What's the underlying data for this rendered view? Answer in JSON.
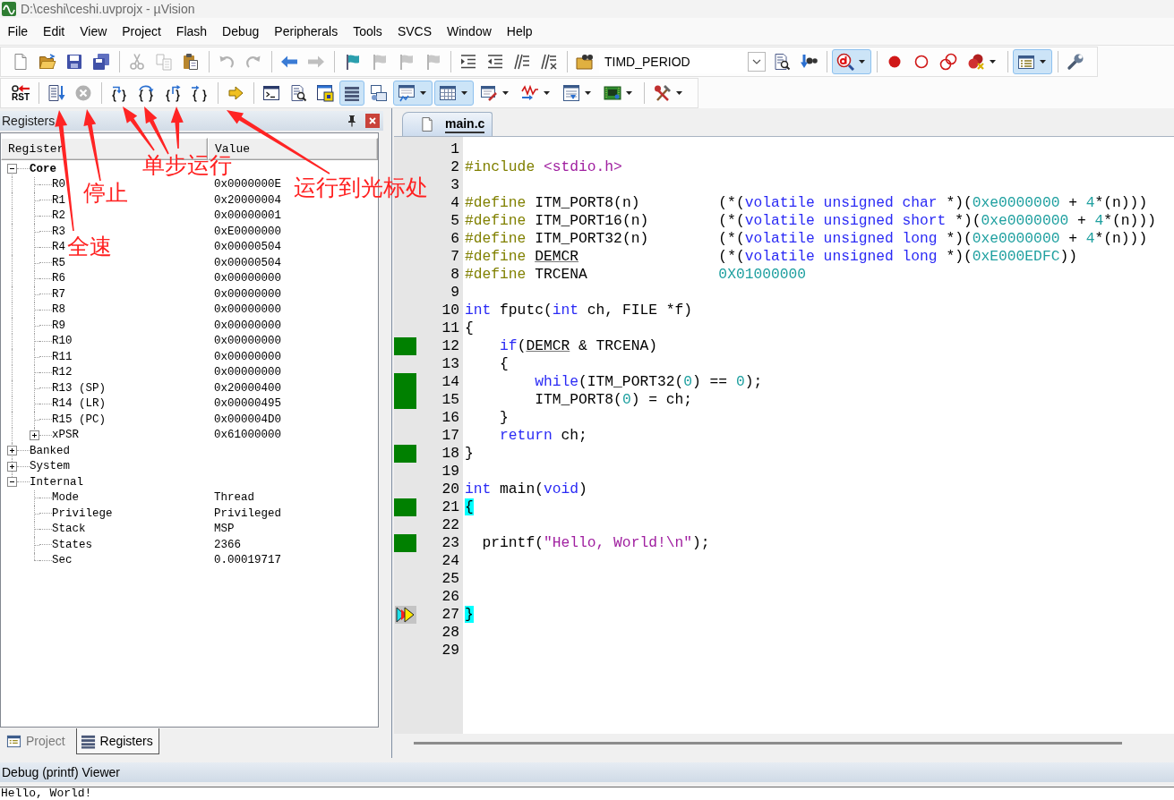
{
  "window": {
    "title": "D:\\ceshi\\ceshi.uvprojx - µVision"
  },
  "menu": [
    "File",
    "Edit",
    "View",
    "Project",
    "Flash",
    "Debug",
    "Peripherals",
    "Tools",
    "SVCS",
    "Window",
    "Help"
  ],
  "toolbar_1": {
    "items": [
      {
        "kind": "button",
        "disabled": false,
        "pressed": false,
        "dropdown": false
      },
      {
        "kind": "button",
        "disabled": false,
        "pressed": false,
        "dropdown": false
      },
      {
        "kind": "button",
        "disabled": false,
        "pressed": false,
        "dropdown": false
      },
      {
        "kind": "button",
        "disabled": false,
        "pressed": false,
        "dropdown": false
      },
      {
        "kind": "separator"
      },
      {
        "kind": "button",
        "disabled": true,
        "pressed": false,
        "dropdown": false
      },
      {
        "kind": "button",
        "disabled": true,
        "pressed": false,
        "dropdown": false
      },
      {
        "kind": "button",
        "disabled": false,
        "pressed": false,
        "dropdown": false
      },
      {
        "kind": "separator"
      },
      {
        "kind": "button",
        "disabled": true,
        "pressed": false,
        "dropdown": false
      },
      {
        "kind": "button",
        "disabled": true,
        "pressed": false,
        "dropdown": false
      },
      {
        "kind": "separator"
      },
      {
        "kind": "button",
        "disabled": false,
        "pressed": false,
        "dropdown": false
      },
      {
        "kind": "button",
        "disabled": true,
        "pressed": false,
        "dropdown": false
      },
      {
        "kind": "separator"
      },
      {
        "kind": "button",
        "disabled": false,
        "pressed": false,
        "dropdown": false
      },
      {
        "kind": "button",
        "disabled": true,
        "pressed": false,
        "dropdown": false
      },
      {
        "kind": "button",
        "disabled": true,
        "pressed": false,
        "dropdown": false
      },
      {
        "kind": "button",
        "disabled": true,
        "pressed": false,
        "dropdown": false
      },
      {
        "kind": "separator"
      },
      {
        "kind": "button",
        "disabled": false,
        "pressed": false,
        "dropdown": false
      },
      {
        "kind": "button",
        "disabled": false,
        "pressed": false,
        "dropdown": false
      },
      {
        "kind": "button",
        "disabled": false,
        "pressed": false,
        "dropdown": false
      },
      {
        "kind": "button",
        "disabled": false,
        "pressed": false,
        "dropdown": false
      },
      {
        "kind": "separator"
      },
      {
        "kind": "button",
        "disabled": false,
        "pressed": false,
        "dropdown": false
      },
      {
        "kind": "combo",
        "value": "TIMD_PERIOD"
      },
      {
        "kind": "button",
        "disabled": false,
        "pressed": false,
        "dropdown": false
      },
      {
        "kind": "button",
        "disabled": false,
        "pressed": false,
        "dropdown": false
      },
      {
        "kind": "separator"
      },
      {
        "kind": "button",
        "disabled": false,
        "pressed": true,
        "dropdown": true
      },
      {
        "kind": "separator"
      },
      {
        "kind": "button",
        "disabled": false,
        "pressed": false,
        "dropdown": false
      },
      {
        "kind": "button",
        "disabled": false,
        "pressed": false,
        "dropdown": false
      },
      {
        "kind": "button",
        "disabled": false,
        "pressed": false,
        "dropdown": false
      },
      {
        "kind": "button",
        "disabled": false,
        "pressed": false,
        "dropdown": true
      },
      {
        "kind": "separator"
      },
      {
        "kind": "button",
        "disabled": false,
        "pressed": true,
        "dropdown": true
      },
      {
        "kind": "separator"
      },
      {
        "kind": "button",
        "disabled": false,
        "pressed": false,
        "dropdown": false
      }
    ]
  },
  "toolbar_2": {
    "items": [
      {
        "kind": "button",
        "label": "RST",
        "disabled": false,
        "pressed": false,
        "dropdown": false
      },
      {
        "kind": "separator"
      },
      {
        "kind": "button",
        "disabled": false,
        "pressed": false,
        "dropdown": false
      },
      {
        "kind": "button",
        "disabled": true,
        "pressed": false,
        "dropdown": false
      },
      {
        "kind": "separator"
      },
      {
        "kind": "button",
        "disabled": false,
        "pressed": false,
        "dropdown": false
      },
      {
        "kind": "button",
        "disabled": false,
        "pressed": false,
        "dropdown": false
      },
      {
        "kind": "button",
        "disabled": false,
        "pressed": false,
        "dropdown": false
      },
      {
        "kind": "button",
        "disabled": false,
        "pressed": false,
        "dropdown": false
      },
      {
        "kind": "separator"
      },
      {
        "kind": "button",
        "disabled": false,
        "pressed": false,
        "dropdown": false
      },
      {
        "kind": "separator"
      },
      {
        "kind": "button",
        "disabled": false,
        "pressed": false,
        "dropdown": false
      },
      {
        "kind": "button",
        "disabled": false,
        "pressed": false,
        "dropdown": false
      },
      {
        "kind": "button",
        "disabled": false,
        "pressed": false,
        "dropdown": false
      },
      {
        "kind": "button",
        "disabled": false,
        "pressed": true,
        "dropdown": false
      },
      {
        "kind": "button",
        "disabled": false,
        "pressed": false,
        "dropdown": false
      },
      {
        "kind": "button",
        "disabled": false,
        "pressed": true,
        "dropdown": true
      },
      {
        "kind": "button",
        "disabled": false,
        "pressed": true,
        "dropdown": true
      },
      {
        "kind": "button",
        "disabled": false,
        "pressed": false,
        "dropdown": true
      },
      {
        "kind": "button",
        "disabled": false,
        "pressed": false,
        "dropdown": true
      },
      {
        "kind": "button",
        "disabled": false,
        "pressed": false,
        "dropdown": true
      },
      {
        "kind": "button",
        "disabled": false,
        "pressed": false,
        "dropdown": true
      },
      {
        "kind": "separator"
      },
      {
        "kind": "button",
        "disabled": false,
        "pressed": false,
        "dropdown": true
      }
    ]
  },
  "registers": {
    "title": "Registers",
    "columns": [
      "Register",
      "Value"
    ],
    "tree": [
      {
        "name": "Core",
        "bold": true,
        "expanded": true,
        "children": [
          {
            "name": "R0",
            "value": "0x0000000E"
          },
          {
            "name": "R1",
            "value": "0x20000004"
          },
          {
            "name": "R2",
            "value": "0x00000001"
          },
          {
            "name": "R3",
            "value": "0xE0000000"
          },
          {
            "name": "R4",
            "value": "0x00000504"
          },
          {
            "name": "R5",
            "value": "0x00000504"
          },
          {
            "name": "R6",
            "value": "0x00000000"
          },
          {
            "name": "R7",
            "value": "0x00000000"
          },
          {
            "name": "R8",
            "value": "0x00000000"
          },
          {
            "name": "R9",
            "value": "0x00000000"
          },
          {
            "name": "R10",
            "value": "0x00000000"
          },
          {
            "name": "R11",
            "value": "0x00000000"
          },
          {
            "name": "R12",
            "value": "0x00000000"
          },
          {
            "name": "R13 (SP)",
            "value": "0x20000400"
          },
          {
            "name": "R14 (LR)",
            "value": "0x00000495"
          },
          {
            "name": "R15 (PC)",
            "value": "0x000004D0"
          },
          {
            "name": "xPSR",
            "value": "0x61000000",
            "expanded": false
          }
        ]
      },
      {
        "name": "Banked",
        "bold": false,
        "expanded": false
      },
      {
        "name": "System",
        "bold": false,
        "expanded": false
      },
      {
        "name": "Internal",
        "bold": false,
        "expanded": true,
        "children": [
          {
            "name": "Mode",
            "value": "Thread"
          },
          {
            "name": "Privilege",
            "value": "Privileged"
          },
          {
            "name": "Stack",
            "value": "MSP"
          },
          {
            "name": "States",
            "value": "2366"
          },
          {
            "name": "Sec",
            "value": "0.00019717"
          }
        ]
      }
    ]
  },
  "panel_tabs": [
    {
      "label": "Project",
      "selected": false
    },
    {
      "label": "Registers",
      "selected": true
    }
  ],
  "editor": {
    "tabs": [
      {
        "label": "main.c",
        "selected": true
      }
    ],
    "lines": [
      {
        "number": "1",
        "executable": false,
        "current": false
      },
      {
        "number": "2",
        "executable": false,
        "current": false,
        "tokens": [
          {
            "kind": "preprocessor",
            "text": "#include "
          },
          {
            "kind": "string",
            "text": "<stdio.h>"
          }
        ]
      },
      {
        "number": "3",
        "executable": false,
        "current": false
      },
      {
        "number": "4",
        "executable": false,
        "current": false,
        "tokens": [
          {
            "kind": "preprocessor",
            "text": "#define"
          },
          {
            "kind": "text",
            "text": " ITM_PORT8(n)         (*("
          },
          {
            "kind": "keyword",
            "text": "volatile unsigned char"
          },
          {
            "kind": "text",
            "text": " *)("
          },
          {
            "kind": "number",
            "text": "0xe0000000"
          },
          {
            "kind": "text",
            "text": " + "
          },
          {
            "kind": "number",
            "text": "4"
          },
          {
            "kind": "text",
            "text": "*(n)))"
          }
        ]
      },
      {
        "number": "5",
        "executable": false,
        "current": false,
        "tokens": [
          {
            "kind": "preprocessor",
            "text": "#define"
          },
          {
            "kind": "text",
            "text": " ITM_PORT16(n)        (*("
          },
          {
            "kind": "keyword",
            "text": "volatile unsigned short"
          },
          {
            "kind": "text",
            "text": " *)("
          },
          {
            "kind": "number",
            "text": "0xe0000000"
          },
          {
            "kind": "text",
            "text": " + "
          },
          {
            "kind": "number",
            "text": "4"
          },
          {
            "kind": "text",
            "text": "*(n)))"
          }
        ]
      },
      {
        "number": "6",
        "executable": false,
        "current": false,
        "tokens": [
          {
            "kind": "preprocessor",
            "text": "#define"
          },
          {
            "kind": "text",
            "text": " ITM_PORT32(n)        (*("
          },
          {
            "kind": "keyword",
            "text": "volatile unsigned long"
          },
          {
            "kind": "text",
            "text": " *)("
          },
          {
            "kind": "number",
            "text": "0xe0000000"
          },
          {
            "kind": "text",
            "text": " + "
          },
          {
            "kind": "number",
            "text": "4"
          },
          {
            "kind": "text",
            "text": "*(n)))"
          }
        ]
      },
      {
        "number": "7",
        "executable": false,
        "current": false,
        "tokens": [
          {
            "kind": "preprocessor",
            "text": "#define "
          },
          {
            "kind": "underlined",
            "text": "DEMCR"
          },
          {
            "kind": "text",
            "text": "                (*("
          },
          {
            "kind": "keyword",
            "text": "volatile unsigned long"
          },
          {
            "kind": "text",
            "text": " *)("
          },
          {
            "kind": "number",
            "text": "0xE000EDFC"
          },
          {
            "kind": "text",
            "text": "))"
          }
        ]
      },
      {
        "number": "8",
        "executable": false,
        "current": false,
        "tokens": [
          {
            "kind": "preprocessor",
            "text": "#define"
          },
          {
            "kind": "text",
            "text": " TRCENA               "
          },
          {
            "kind": "number",
            "text": "0X01000000"
          }
        ]
      },
      {
        "number": "9",
        "executable": false,
        "current": false
      },
      {
        "number": "10",
        "executable": false,
        "current": false,
        "tokens": [
          {
            "kind": "keyword",
            "text": "int"
          },
          {
            "kind": "text",
            "text": " fputc("
          },
          {
            "kind": "keyword",
            "text": "int"
          },
          {
            "kind": "text",
            "text": " ch, FILE *f)"
          }
        ]
      },
      {
        "number": "11",
        "executable": false,
        "current": false,
        "tokens": [
          {
            "kind": "text",
            "text": "{"
          }
        ]
      },
      {
        "number": "12",
        "executable": true,
        "current": false,
        "tokens": [
          {
            "kind": "keyword",
            "text": "    if"
          },
          {
            "kind": "text",
            "text": "("
          },
          {
            "kind": "underlined",
            "text": "DEMCR"
          },
          {
            "kind": "text",
            "text": " & TRCENA)"
          }
        ]
      },
      {
        "number": "13",
        "executable": false,
        "current": false,
        "tokens": [
          {
            "kind": "text",
            "text": "    {"
          }
        ]
      },
      {
        "number": "14",
        "executable": true,
        "current": false,
        "tokens": [
          {
            "kind": "keyword",
            "text": "        while"
          },
          {
            "kind": "text",
            "text": "(ITM_PORT32("
          },
          {
            "kind": "number",
            "text": "0"
          },
          {
            "kind": "text",
            "text": ") == "
          },
          {
            "kind": "number",
            "text": "0"
          },
          {
            "kind": "text",
            "text": ");"
          }
        ]
      },
      {
        "number": "15",
        "executable": true,
        "current": false,
        "tokens": [
          {
            "kind": "text",
            "text": "        ITM_PORT8("
          },
          {
            "kind": "number",
            "text": "0"
          },
          {
            "kind": "text",
            "text": ") = ch;"
          }
        ]
      },
      {
        "number": "16",
        "executable": false,
        "current": false,
        "tokens": [
          {
            "kind": "text",
            "text": "    }"
          }
        ]
      },
      {
        "number": "17",
        "executable": false,
        "current": false,
        "tokens": [
          {
            "kind": "keyword",
            "text": "    return"
          },
          {
            "kind": "text",
            "text": " ch;"
          }
        ]
      },
      {
        "number": "18",
        "executable": true,
        "current": false,
        "tokens": [
          {
            "kind": "text",
            "text": "}"
          }
        ]
      },
      {
        "number": "19",
        "executable": false,
        "current": false
      },
      {
        "number": "20",
        "executable": false,
        "current": false,
        "tokens": [
          {
            "kind": "keyword",
            "text": "int"
          },
          {
            "kind": "text",
            "text": " main("
          },
          {
            "kind": "keyword",
            "text": "void"
          },
          {
            "kind": "text",
            "text": ")"
          }
        ]
      },
      {
        "number": "21",
        "executable": true,
        "current": false,
        "tokens": [
          {
            "kind": "match",
            "text": "{"
          }
        ]
      },
      {
        "number": "22",
        "executable": false,
        "current": false
      },
      {
        "number": "23",
        "executable": true,
        "current": false,
        "tokens": [
          {
            "kind": "text",
            "text": "  printf("
          },
          {
            "kind": "string",
            "text": "\"Hello, World!\\n\""
          },
          {
            "kind": "text",
            "text": ");"
          }
        ]
      },
      {
        "number": "24",
        "executable": false,
        "current": false
      },
      {
        "number": "25",
        "executable": false,
        "current": false
      },
      {
        "number": "26",
        "executable": false,
        "current": false
      },
      {
        "number": "27",
        "executable": false,
        "current": true,
        "tokens": [
          {
            "kind": "match",
            "text": "}"
          }
        ]
      },
      {
        "number": "28",
        "executable": false,
        "current": false
      },
      {
        "number": "29",
        "executable": false,
        "current": false
      }
    ]
  },
  "debug_viewer": {
    "title": "Debug (printf) Viewer",
    "output": "Hello, World!"
  },
  "annotations": [
    {
      "label": "全速"
    },
    {
      "label": "停止"
    },
    {
      "label": "单步运行"
    },
    {
      "label": "运行到光标处"
    }
  ]
}
